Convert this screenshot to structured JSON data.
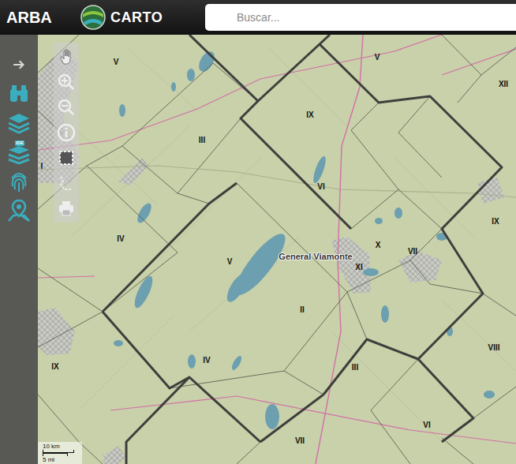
{
  "header": {
    "title": "ARBA",
    "logo": "CARTO"
  },
  "search": {
    "placeholder": "Buscar..."
  },
  "sidebar": {
    "ide_badge": "IDE"
  },
  "map": {
    "regions": [
      "V",
      "V",
      "XII",
      "IX",
      "III",
      "VI",
      "IX",
      "I",
      "IV",
      "V",
      "X",
      "VII",
      "XI",
      "II",
      "VIII",
      "IV",
      "III",
      "IX",
      "VI",
      "VII"
    ],
    "places": [
      "General Viamonte"
    ],
    "scale": {
      "metric": "10 km",
      "imperial": "5 mi"
    }
  }
}
